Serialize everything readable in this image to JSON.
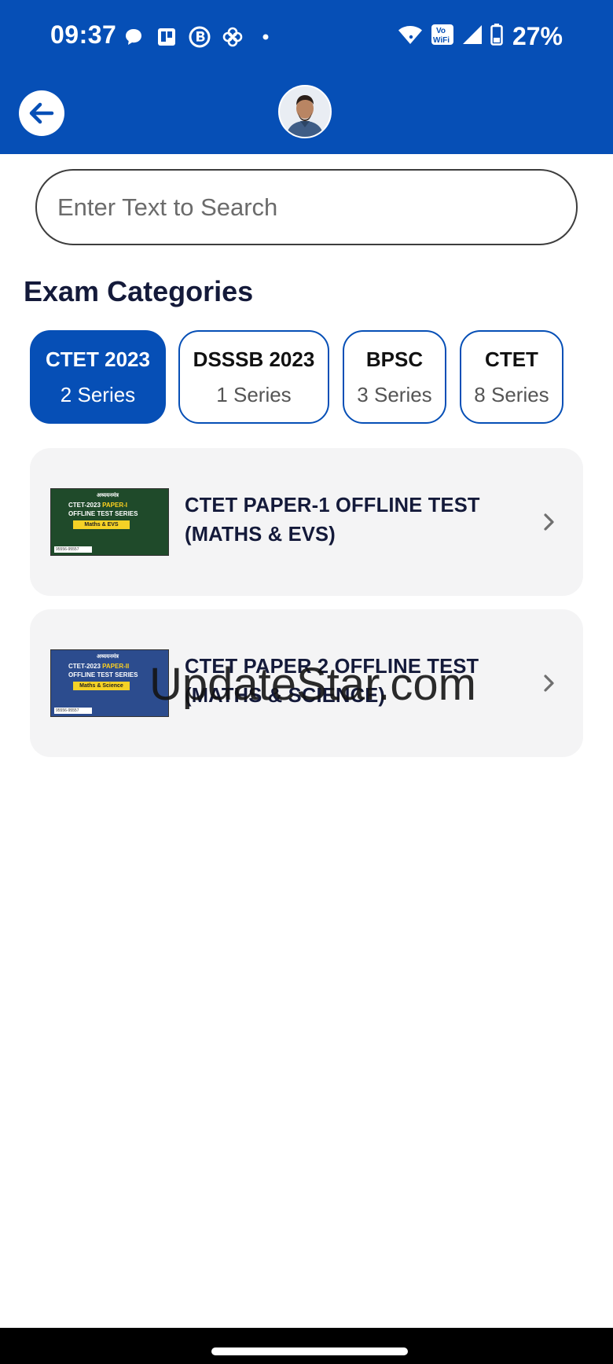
{
  "status_bar": {
    "time": "09:37",
    "battery": "27%",
    "notification_icons": [
      "chat-bubble-icon",
      "trello-icon",
      "b-app-icon",
      "pinwheel-icon",
      "dot-icon"
    ],
    "system_icons": [
      "wifi-icon",
      "vowifi-icon",
      "signal-icon",
      "battery-icon"
    ],
    "vowifi_label_top": "Vo",
    "vowifi_label_bottom": "WiFi"
  },
  "header": {
    "back_icon": "arrow-left-icon",
    "avatar": "profile-avatar",
    "background_color": "#064fb6"
  },
  "search": {
    "placeholder": "Enter Text to Search",
    "value": ""
  },
  "section_title": "Exam Categories",
  "categories": [
    {
      "name": "CTET 2023",
      "count": "2 Series",
      "active": true
    },
    {
      "name": "DSSSB 2023",
      "count": "1 Series",
      "active": false
    },
    {
      "name": "BPSC",
      "count": "3 Series",
      "active": false
    },
    {
      "name": "CTET",
      "count": "8 Series",
      "active": false
    }
  ],
  "series": [
    {
      "title_line1": "CTET PAPER-1 OFFLINE TEST",
      "title_line2": "(MATHS & EVS)",
      "thumb_brand": "अध्ययनमंत्र",
      "thumb_heading_a": "CTET-2023",
      "thumb_heading_b": "PAPER-I",
      "thumb_sub_a": "OFFLINE",
      "thumb_sub_b": "TEST SERIES",
      "thumb_subject": "Maths & EVS",
      "thumb_phone": "95556-95557",
      "thumb_color": "#1f4a2a"
    },
    {
      "title_line1": "CTET PAPER 2 OFFLINE TEST",
      "title_line2": "(MATHS & SCIENCE)",
      "thumb_brand": "अध्ययनमंत्र",
      "thumb_heading_a": "CTET-2023",
      "thumb_heading_b": "PAPER-II",
      "thumb_sub_a": "OFFLINE",
      "thumb_sub_b": "TEST SERIES",
      "thumb_subject": "Maths & Science",
      "thumb_phone": "95556-95557",
      "thumb_color": "#2c4c8e"
    }
  ],
  "watermark": "UpdateStar.com",
  "colors": {
    "accent": "#064fb6",
    "card_bg": "#f4f4f5",
    "text_dark": "#141a3a"
  }
}
